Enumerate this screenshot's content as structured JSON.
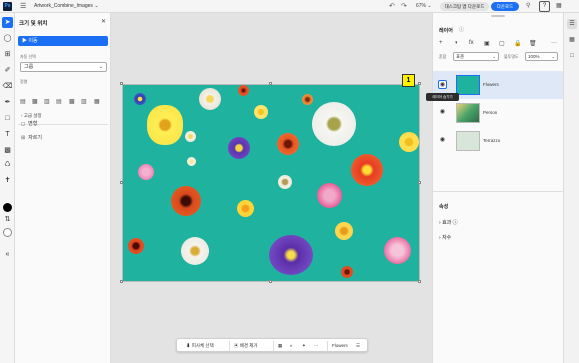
{
  "app": {
    "logo": "Ps",
    "filename": "Artwork_Combine_Images",
    "zoom": "67%",
    "share_button": "대스크탑 앱 다운로드",
    "download_button": "다운로드"
  },
  "tools": [
    "select-tool",
    "lasso-tool",
    "crop-tool",
    "brush-tool",
    "eraser-tool",
    "pen-tool",
    "shape-tool",
    "type-tool",
    "fill-tool",
    "clone-tool",
    "eyedropper-tool",
    "swap-colors",
    "expand-tool"
  ],
  "properties_panel": {
    "title": "크기 및 위치",
    "selected_item": "이동",
    "auto_select_label": "자동 선택",
    "auto_select_value": "그룹",
    "align_label": "정렬",
    "advanced_label": "고급 설정",
    "transform_label": "변형",
    "crop_label": "자르기"
  },
  "layers_panel": {
    "title": "레이어",
    "blend_label": "혼합",
    "blend_value": "표준",
    "opacity_label": "불투명도",
    "opacity_value": "100%",
    "layers": [
      {
        "name": "Flowers",
        "selected": true
      },
      {
        "name": "Person",
        "selected": false
      },
      {
        "name": "Terrazzo",
        "selected": false
      }
    ],
    "tooltip": "레이어 숨기기",
    "properties_title": "속성",
    "effects_label": "효과",
    "properties_label": "자수"
  },
  "badge": "1",
  "float_bar": {
    "select_subject": "피사체 선택",
    "remove_bg": "배경 제거",
    "layer_name": "Flowers"
  },
  "colors": {
    "accent": "#1a6ff2",
    "canvas_bg": "#1fb39f"
  }
}
